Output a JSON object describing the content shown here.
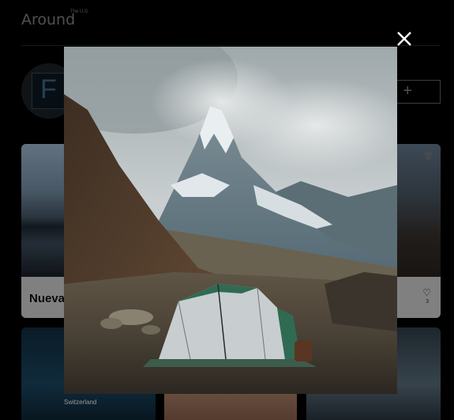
{
  "header": {
    "logo": "Around",
    "logo_sup": "The U.S."
  },
  "profile": {
    "initial": "F"
  },
  "add_button": {
    "icon": "plus-icon"
  },
  "cards": [
    {
      "title": "Nueva",
      "likes": "3"
    }
  ],
  "second_row": {
    "label": "Switzerland"
  },
  "modal": {
    "close_icon": "close-icon"
  }
}
